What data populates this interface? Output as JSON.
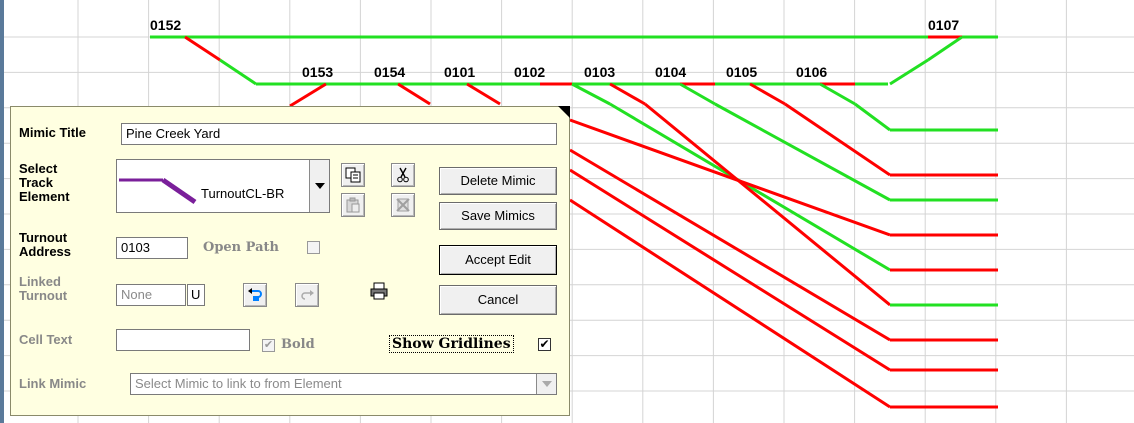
{
  "grid": {
    "column_labels": [
      "0152",
      "0153",
      "0154",
      "0101",
      "0102",
      "0103",
      "0104",
      "0105",
      "0106",
      "0107"
    ]
  },
  "colors": {
    "track_green": "#22e022",
    "track_red": "#ff0000",
    "grid": "#d4d4d4",
    "panel_bg": "#ffffe1",
    "element_icon": "#7a1f9a"
  },
  "panel": {
    "mimic_title_label": "Mimic Title",
    "mimic_title_value": "Pine Creek Yard",
    "select_track_label_1": "Select",
    "select_track_label_2": "Track",
    "select_track_label_3": "Element",
    "track_element_value": "TurnoutCL-BR",
    "turnout_address_label_1": "Turnout",
    "turnout_address_label_2": "Address",
    "turnout_address_value": "0103",
    "open_path_label": "Open Path",
    "linked_turnout_label_1": "Linked",
    "linked_turnout_label_2": "Turnout",
    "linked_turnout_value": "None",
    "linked_turnout_suffix": "U",
    "cell_text_label": "Cell Text",
    "cell_text_value": "",
    "bold_label": "Bold",
    "show_gridlines_label": "Show Gridlines",
    "show_gridlines_checked": true,
    "link_mimic_label": "Link Mimic",
    "link_mimic_placeholder": "Select Mimic to link to from Element",
    "buttons": {
      "delete": "Delete Mimic",
      "save": "Save Mimics",
      "accept": "Accept Edit",
      "cancel": "Cancel"
    },
    "icons": [
      "copy-icon",
      "cut-icon",
      "paste-icon",
      "delete-element-icon",
      "undo-icon",
      "redo-icon",
      "print-icon"
    ]
  }
}
